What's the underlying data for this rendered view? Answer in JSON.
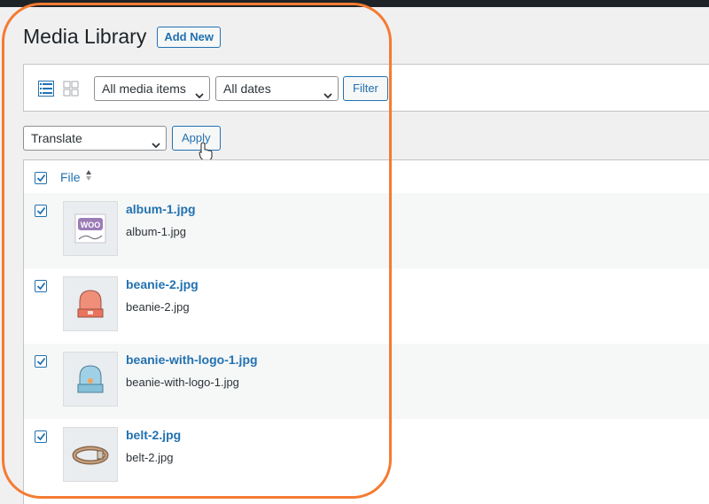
{
  "header": {
    "title": "Media Library",
    "add_new_label": "Add New"
  },
  "filters": {
    "view_icons": [
      "list-view-icon",
      "grid-view-icon"
    ],
    "media_type": "All media items",
    "dates": "All dates",
    "filter_label": "Filter"
  },
  "bulk": {
    "action": "Translate",
    "apply_label": "Apply"
  },
  "table": {
    "column_file": "File",
    "rows": [
      {
        "title": "album-1.jpg",
        "filename": "album-1.jpg",
        "checked": true
      },
      {
        "title": "beanie-2.jpg",
        "filename": "beanie-2.jpg",
        "checked": true
      },
      {
        "title": "beanie-with-logo-1.jpg",
        "filename": "beanie-with-logo-1.jpg",
        "checked": true
      },
      {
        "title": "belt-2.jpg",
        "filename": "belt-2.jpg",
        "checked": true
      }
    ]
  },
  "colors": {
    "accent": "#2271b1",
    "highlight": "#f47b32"
  }
}
